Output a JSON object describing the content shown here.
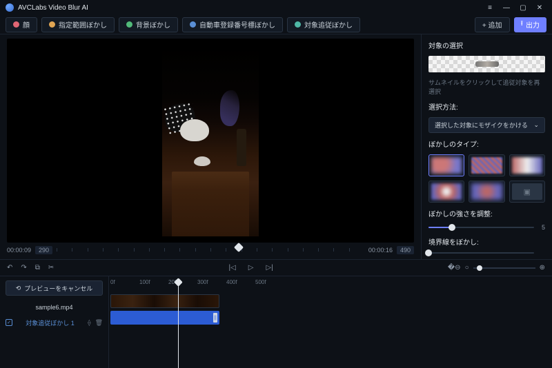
{
  "app": {
    "title": "AVCLabs Video Blur AI"
  },
  "modes": {
    "face": "顔",
    "fixed": "指定範囲ぼかし",
    "background": "背景ぼかし",
    "plate": "自動車登録番号標ぼかし",
    "track": "対象追従ぼかし"
  },
  "toolbar": {
    "add": "+ 追加",
    "export": "出力"
  },
  "preview": {
    "time_current": "00:00:09",
    "frame_current": "290",
    "time_total": "00:00:16",
    "frame_total": "490"
  },
  "side": {
    "select_title": "対象の選択",
    "hint": "サムネイルをクリックして追従対象を再選択",
    "method_label": "選択方法:",
    "method_value": "選択した対象にモザイクをかける",
    "type_label": "ぼかしのタイプ:",
    "strength_label": "ぼかしの強さを調整:",
    "strength_value": "5",
    "edge_label": "境界線をぼかし:"
  },
  "timeline": {
    "cancel": "プレビューをキャンセル",
    "video_name": "sample6.mp4",
    "blur_track": "対象追従ぼかし 1",
    "ruler": [
      "0f",
      "100f",
      "200f",
      "300f",
      "400f",
      "500f"
    ]
  }
}
